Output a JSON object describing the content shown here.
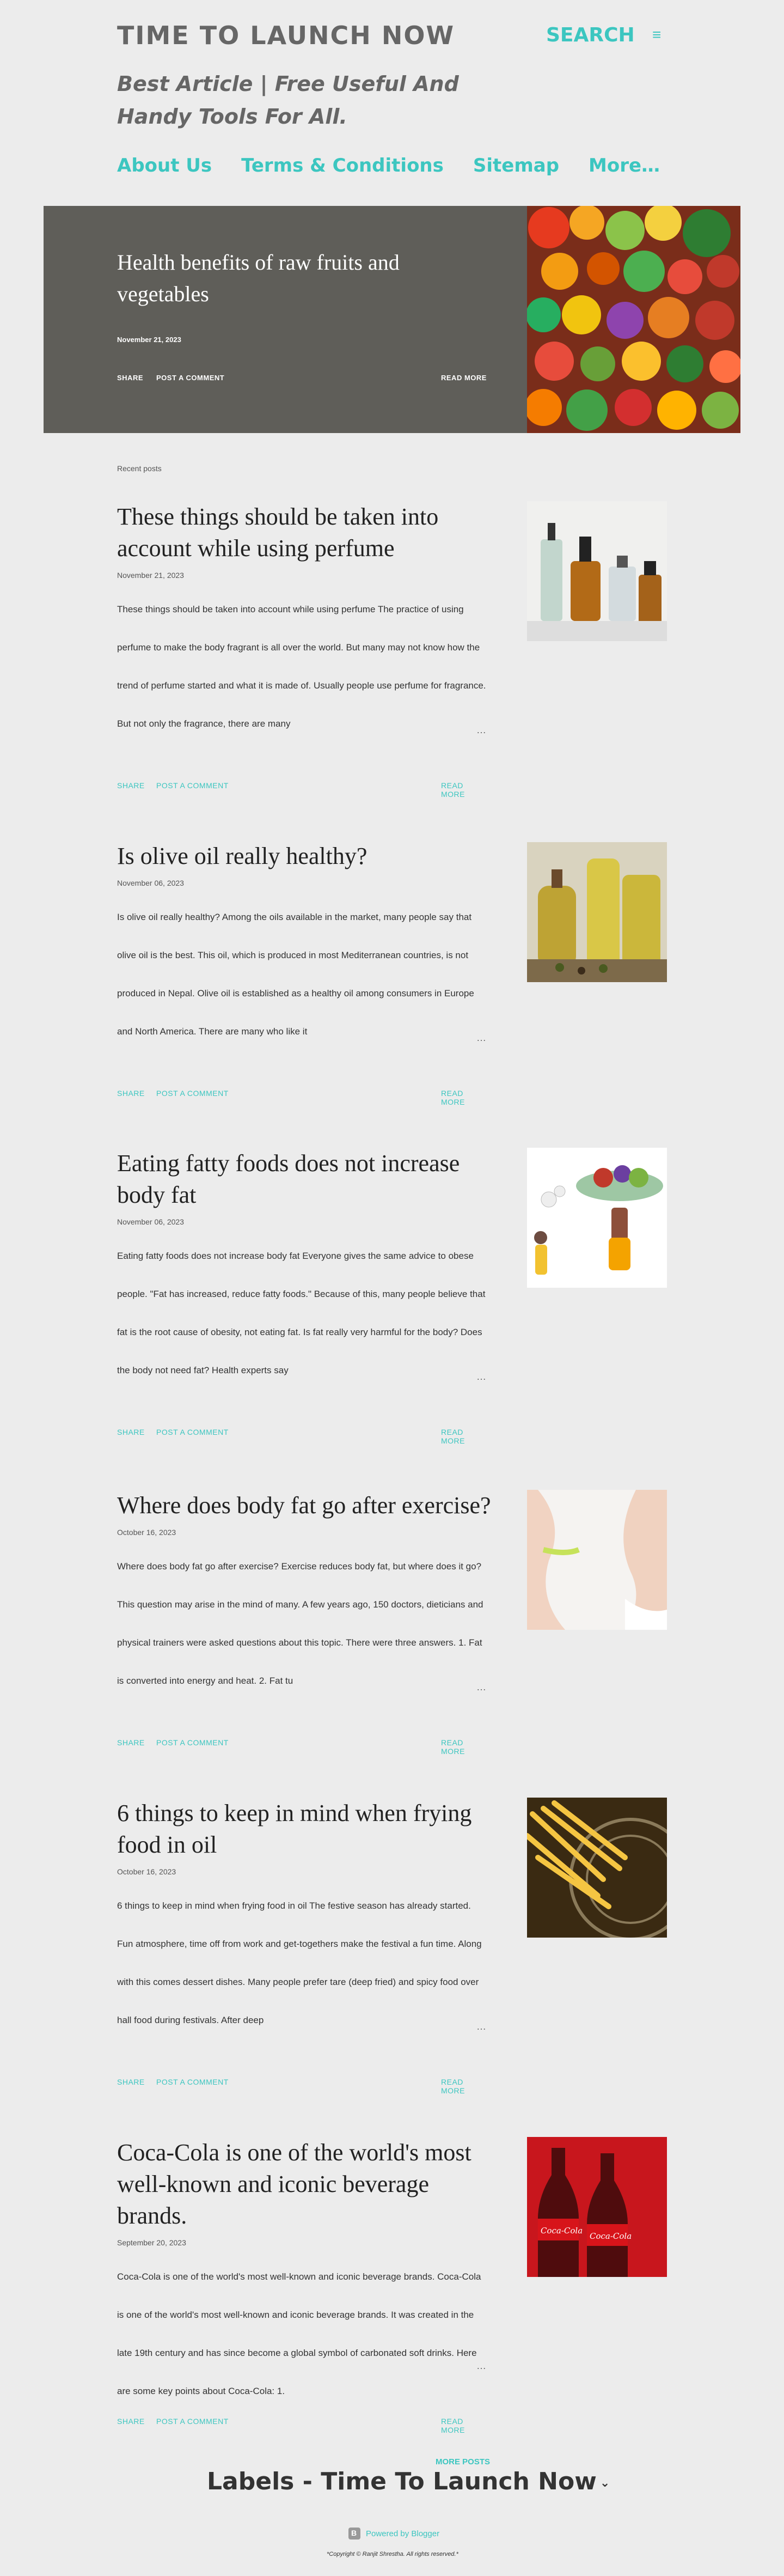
{
  "header": {
    "title": "TIME TO LAUNCH NOW",
    "search_label": "SEARCH",
    "menu_icon": "≡",
    "description": "Best Article | Free Useful And Handy Tools For All."
  },
  "nav": {
    "items": [
      "About Us",
      "Terms & Conditions",
      "Sitemap",
      "More…"
    ]
  },
  "featured": {
    "title": "Health benefits of raw fruits and vegetables",
    "date": "November 21, 2023",
    "share": "SHARE",
    "comment": "POST A COMMENT",
    "read_more": "READ MORE"
  },
  "recent_label": "Recent posts",
  "posts": [
    {
      "title": "These things should be taken into account while using perfume",
      "date": "November 21, 2023",
      "snippet": " These things should be taken into account while using perfume The practice of using perfume to make the body fragrant is all over the world. But many may not know how the trend of perfume started and what it is made of. Usually people use perfume for fragrance. But not only the fragrance, there are many"
    },
    {
      "title": "Is olive oil really healthy?",
      "date": "November 06, 2023",
      "snippet": " Is olive oil really healthy?  Among the oils available in the market, many people say that olive oil is the best. This oil, which is produced in most Mediterranean countries, is not produced in Nepal. Olive oil is established as a healthy oil among consumers in Europe and North America. There are many who like it"
    },
    {
      "title": "Eating fatty foods does not increase body fat",
      "date": "November 06, 2023",
      "snippet": " Eating fatty foods does not increase body fat Everyone gives the same advice to obese people. \"Fat has increased, reduce fatty foods.\" Because of this, many people believe that fat is the root cause of obesity, not eating fat. Is fat really very harmful for the body? Does the body not need fat? Health experts say"
    },
    {
      "title": "Where does body fat go after exercise?",
      "date": "October 16, 2023",
      "snippet": " Where does body fat go after exercise? Exercise reduces body fat, but where does it go? This question may arise in the mind of many. A few years ago, 150 doctors, dieticians and physical trainers were asked questions about this topic. There were three answers. 1. Fat is converted into energy and heat. 2. Fat tu"
    },
    {
      "title": "6 things to keep in mind when frying food in oil",
      "date": "October 16, 2023",
      "snippet": " 6 things to keep in mind when frying food in oil The festive season has already started. Fun atmosphere, time off from work and get-togethers make the festival a fun time. Along with this comes dessert dishes. Many people prefer tare (deep fried) and spicy food over hall food during festivals. After deep"
    },
    {
      "title": "Coca-Cola is one of the world's most well-known and iconic beverage brands.",
      "date": "September 20, 2023",
      "snippet": " Coca-Cola is one of the world's most well-known and iconic beverage brands. Coca-Cola is one of the world's most well-known and iconic beverage brands. It was created in the late 19th century and has since become a global symbol of carbonated soft drinks. Here are some key points about Coca-Cola: 1."
    }
  ],
  "post_actions": {
    "share": "SHARE",
    "comment": "POST A COMMENT",
    "read_more": "READ MORE",
    "ellipsis": "…"
  },
  "thumb_brand_text": "Coca-Cola",
  "footer": {
    "more_posts": "MORE POSTS",
    "labels_title": "Labels - Time To Launch Now",
    "powered_by": "Powered by Blogger",
    "copyright": "*Copyright © Ranjit Shrestha. All rights reserved.*"
  }
}
